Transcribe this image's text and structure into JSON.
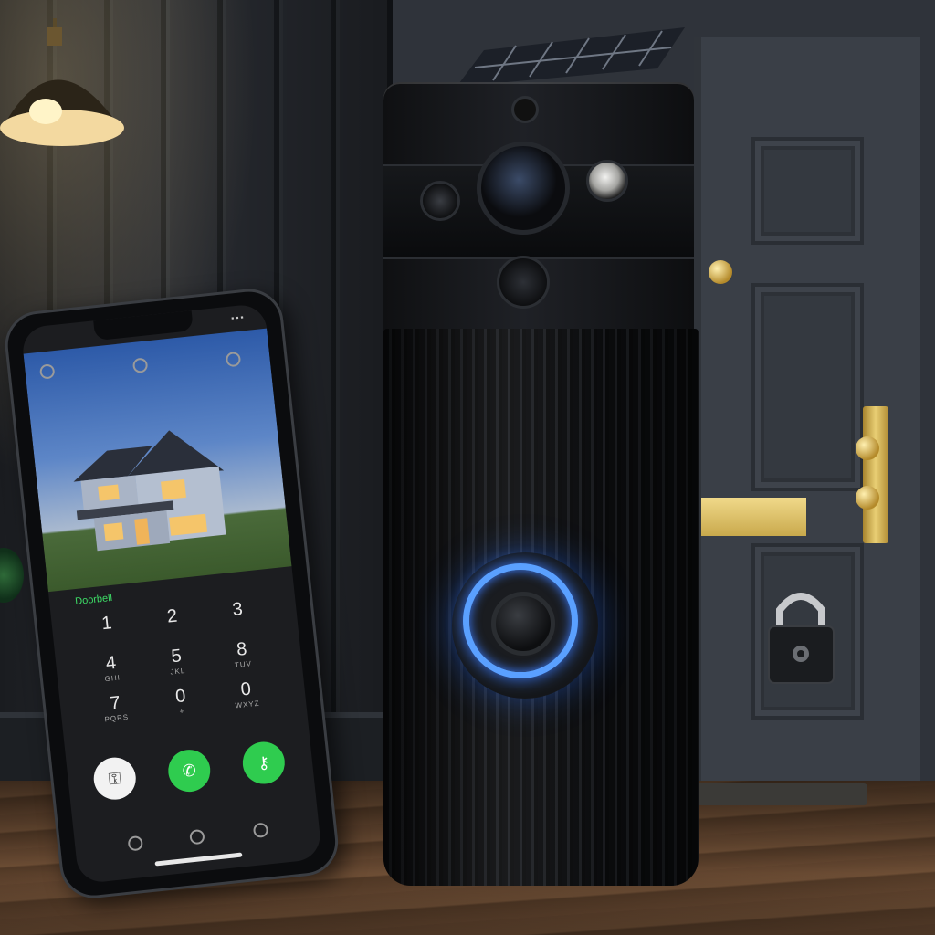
{
  "scene": {
    "description_free": true
  },
  "phone": {
    "status_left": "",
    "label": "Doorbell",
    "keypad": [
      {
        "digit": "1",
        "letters": ""
      },
      {
        "digit": "2",
        "letters": ""
      },
      {
        "digit": "3",
        "letters": ""
      },
      {
        "digit": "4",
        "letters": "GHI"
      },
      {
        "digit": "5",
        "letters": "JKL"
      },
      {
        "digit": "8",
        "letters": "TUV"
      },
      {
        "digit": "7",
        "letters": "PQRS"
      },
      {
        "digit": "0",
        "letters": "+"
      },
      {
        "digit": "0",
        "letters": "WXYZ"
      }
    ],
    "call_buttons": [
      {
        "icon": "key-icon",
        "color": "#f2f2f2"
      },
      {
        "icon": "phone-icon",
        "color": "#2fcc4f"
      },
      {
        "icon": "unlock-icon",
        "color": "#2fcc4f"
      }
    ]
  },
  "colors": {
    "ring_glow": "#5aa0ff",
    "brass": "#d8b75a",
    "accept_green": "#2fcc4f"
  }
}
